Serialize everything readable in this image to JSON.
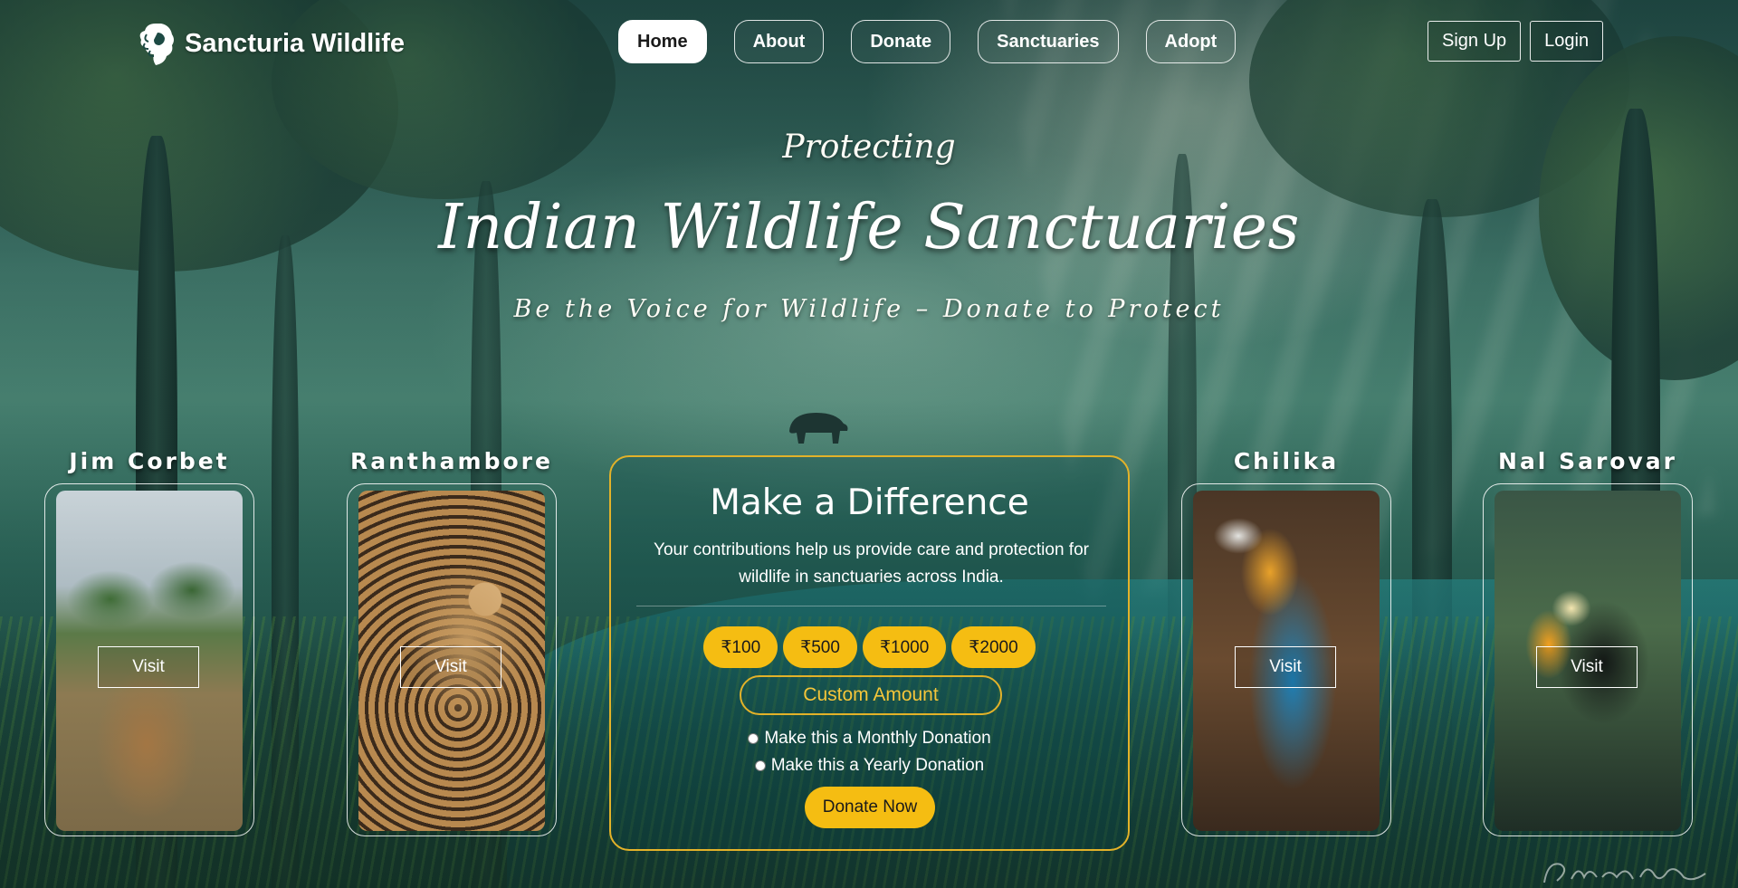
{
  "brand": {
    "name": "Sancturia Wildlife",
    "logo_icon": "lion-head-icon"
  },
  "nav": {
    "items": [
      {
        "label": "Home",
        "active": true
      },
      {
        "label": "About",
        "active": false
      },
      {
        "label": "Donate",
        "active": false
      },
      {
        "label": "Sanctuaries",
        "active": false
      },
      {
        "label": "Adopt",
        "active": false
      }
    ]
  },
  "auth": {
    "signup_label": "Sign Up",
    "login_label": "Login"
  },
  "hero": {
    "kicker": "Protecting",
    "title": "Indian Wildlife Sanctuaries",
    "subtitle": "Be the Voice for Wildlife – Donate to Protect"
  },
  "sanctuaries": [
    {
      "name": "Jim Corbet",
      "image": "deer-photo",
      "visit_label": "Visit"
    },
    {
      "name": "Ranthambore",
      "image": "leopard-photo",
      "visit_label": "Visit"
    },
    {
      "name": "Chilika",
      "image": "parrot-photo",
      "visit_label": "Visit"
    },
    {
      "name": "Nal Sarovar",
      "image": "toucan-photo",
      "visit_label": "Visit"
    }
  ],
  "donation": {
    "title": "Make a Difference",
    "description": "Your contributions help us provide care and protection for wildlife in sanctuaries across India.",
    "amounts": [
      "₹100",
      "₹500",
      "₹1000",
      "₹2000"
    ],
    "custom_label": "Custom Amount",
    "monthly_label": "Make this a Monthly Donation",
    "yearly_label": "Make this a Yearly Donation",
    "submit_label": "Donate Now"
  },
  "colors": {
    "accent": "#f5bd12",
    "accent_border": "#e3b229",
    "text": "#ffffff"
  }
}
